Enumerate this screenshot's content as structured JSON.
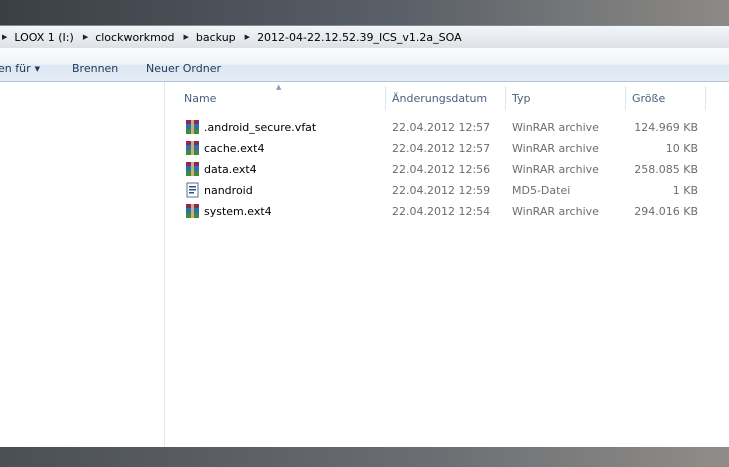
{
  "address_bar": {
    "crumbs": [
      "LOOX 1 (I:)",
      "clockworkmod",
      "backup",
      "2012-04-22.12.52.39_ICS_v1.2a_SOA"
    ]
  },
  "toolbar": {
    "share_label": "en für",
    "burn_label": "Brennen",
    "new_folder_label": "Neuer Ordner"
  },
  "columns": {
    "name": "Name",
    "date": "Änderungsdatum",
    "type": "Typ",
    "size": "Größe"
  },
  "files": [
    {
      "name": ".android_secure.vfat",
      "date": "22.04.2012 12:57",
      "type": "WinRAR archive",
      "size": "124.969 KB",
      "icon": "winrar-icon"
    },
    {
      "name": "cache.ext4",
      "date": "22.04.2012 12:57",
      "type": "WinRAR archive",
      "size": "10 KB",
      "icon": "winrar-icon"
    },
    {
      "name": "data.ext4",
      "date": "22.04.2012 12:56",
      "type": "WinRAR archive",
      "size": "258.085 KB",
      "icon": "winrar-icon"
    },
    {
      "name": "nandroid",
      "date": "22.04.2012 12:59",
      "type": "MD5-Datei",
      "size": "1 KB",
      "icon": "md5-file-icon"
    },
    {
      "name": "system.ext4",
      "date": "22.04.2012 12:54",
      "type": "WinRAR archive",
      "size": "294.016 KB",
      "icon": "winrar-icon"
    }
  ],
  "colors": {
    "toolbar_text": "#1e395b",
    "header_text": "#4c607a",
    "detail_text": "#6d6d6d"
  }
}
